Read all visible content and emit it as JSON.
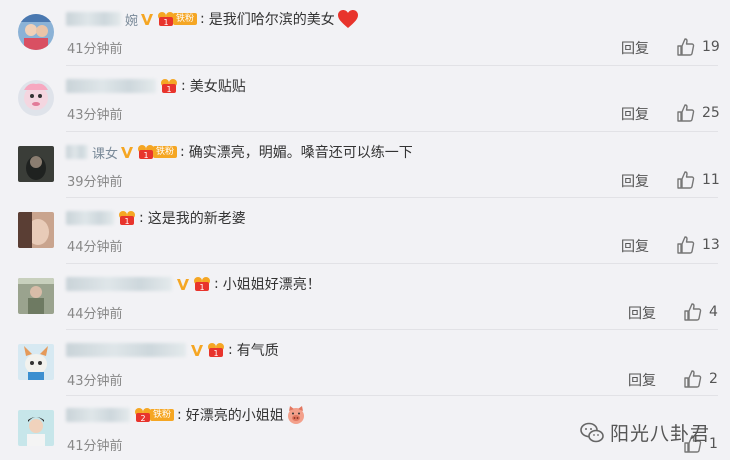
{
  "comments": [
    {
      "name_fragment": "婉",
      "verified": true,
      "fan_badge": "铁粉",
      "fan_level": "1",
      "text": "是我们哈尔滨的美女",
      "emoji": "heart",
      "time": "41分钟前",
      "reply_label": "回复",
      "likes": "19"
    },
    {
      "name_fragment": "",
      "verified": false,
      "fan_badge": "",
      "fan_level": "1",
      "text": "美女贴贴",
      "emoji": "",
      "time": "43分钟前",
      "reply_label": "回复",
      "likes": "25"
    },
    {
      "name_fragment": "课女",
      "verified": true,
      "fan_badge": "铁粉",
      "fan_level": "1",
      "text": "确实漂亮，明媚。嗓音还可以练一下",
      "emoji": "",
      "time": "39分钟前",
      "reply_label": "回复",
      "likes": "11"
    },
    {
      "name_fragment": "",
      "verified": false,
      "fan_badge": "",
      "fan_level": "1",
      "text": "这是我的新老婆",
      "emoji": "",
      "time": "44分钟前",
      "reply_label": "回复",
      "likes": "13"
    },
    {
      "name_fragment": "",
      "verified": true,
      "fan_badge": "",
      "fan_level": "1",
      "text": "小姐姐好漂亮！",
      "emoji": "",
      "time": "44分钟前",
      "reply_label": "回复",
      "likes": "4"
    },
    {
      "name_fragment": "",
      "verified": true,
      "fan_badge": "",
      "fan_level": "1",
      "text": "有气质",
      "emoji": "",
      "time": "43分钟前",
      "reply_label": "回复",
      "likes": "2"
    },
    {
      "name_fragment": "",
      "verified": false,
      "fan_badge": "铁粉",
      "fan_level": "2",
      "text": "好漂亮的小姐姐",
      "emoji": "pig-face",
      "time": "41分钟前",
      "reply_label": "回复",
      "likes": "1"
    }
  ],
  "watermark": {
    "text": "阳光八卦君",
    "icon": "wechat-icon"
  },
  "colors": {
    "background": "#f2f2f5",
    "verified": "#f5a623",
    "fan_badge": "#f5a623",
    "heart": "#e8342c"
  }
}
